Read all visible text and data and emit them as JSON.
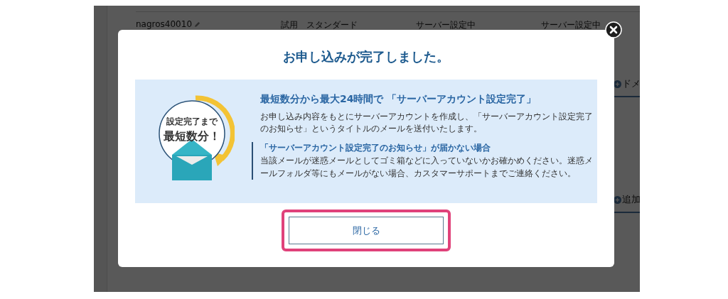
{
  "background": {
    "row": [
      "nagros40010",
      "試用",
      "スタンダード",
      "サーバー設定中",
      "サーバー設定中"
    ],
    "side_links": [
      "ドメ",
      "追加"
    ]
  },
  "modal": {
    "title": "お申し込みが完了しました。",
    "badge": {
      "caption": "設定完了まで",
      "headline": "最短数分！"
    },
    "heading": "最短数分から最大24時間で 「サーバーアカウント設定完了」",
    "body": "お申し込み内容をもとにサーバーアカウントを作成し、「サーバーアカウント設定完了のお知らせ」というタイトルのメールを送付いたします。",
    "note": {
      "title": "「サーバーアカウント設定完了のお知らせ」が届かない場合",
      "body": "当該メールが迷惑メールとしてゴミ箱などに入っていないかお確かめください。迷惑メールフォルダ等にもメールがない場合、カスタマーサポートまでご連絡ください。"
    },
    "close_button": {
      "label": "閉じる",
      "highlighted": true
    }
  }
}
